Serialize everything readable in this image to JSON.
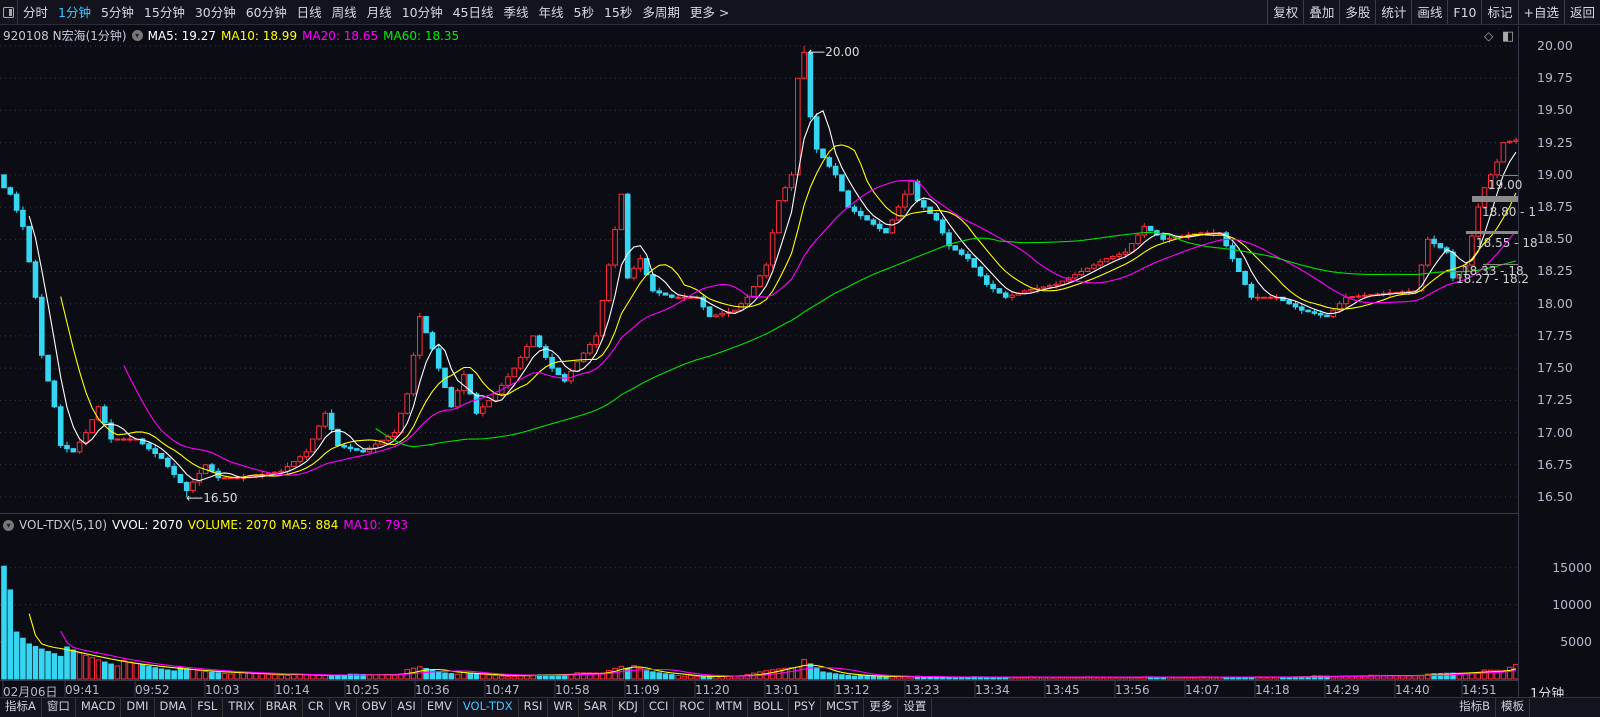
{
  "toolbar": {
    "periods": [
      "分时",
      "1分钟",
      "5分钟",
      "15分钟",
      "30分钟",
      "60分钟",
      "日线",
      "周线",
      "月线",
      "10分钟",
      "45日线",
      "季线",
      "年线",
      "5秒",
      "15秒",
      "多周期",
      "更多 >"
    ],
    "active_period": "1分钟",
    "right_buttons": [
      "复权",
      "叠加",
      "多股",
      "统计",
      "画线",
      "F10",
      "标记",
      "+自选",
      "返回"
    ]
  },
  "main_info": {
    "title": "920108 N宏海(1分钟)",
    "ma5": "MA5: 19.27",
    "ma10": "MA10: 18.99",
    "ma20": "MA20: 18.65",
    "ma60": "MA60: 18.35"
  },
  "vol_info": {
    "title": "VOL-TDX(5,10)",
    "vvol": "VVOL: 2070",
    "volume": "VOLUME: 2070",
    "ma5": "MA5: 884",
    "ma10": "MA10: 793"
  },
  "price_axis": [
    "20.00",
    "19.75",
    "19.50",
    "19.25",
    "19.00",
    "18.75",
    "18.50",
    "18.25",
    "18.00",
    "17.75",
    "17.50",
    "17.25",
    "17.00",
    "16.75",
    "16.50"
  ],
  "volume_axis": [
    "15000",
    "10000",
    "5000"
  ],
  "time_axis": [
    "02月06日",
    "09:41",
    "09:52",
    "10:03",
    "10:14",
    "10:25",
    "10:36",
    "10:47",
    "10:58",
    "11:09",
    "11:20",
    "13:01",
    "13:12",
    "13:23",
    "13:34",
    "13:45",
    "13:56",
    "14:07",
    "14:18",
    "14:29",
    "14:40",
    "14:51"
  ],
  "period_label": "1分钟",
  "annotations": {
    "high": "20.00",
    "low": "16.50"
  },
  "ranges": [
    "19.00",
    "18.80 - 1",
    "18.55 - 18",
    "18.33 - 18",
    "18.27 - 18.2"
  ],
  "bottom_tabs": [
    "指标A",
    "窗口",
    "MACD",
    "DMI",
    "DMA",
    "FSL",
    "TRIX",
    "BRAR",
    "CR",
    "VR",
    "OBV",
    "ASI",
    "EMV",
    "VOL-TDX",
    "RSI",
    "WR",
    "SAR",
    "KDJ",
    "CCI",
    "ROC",
    "MTM",
    "BOLL",
    "PSY",
    "MCST",
    "更多",
    "设置"
  ],
  "bottom_tabs_right": [
    "指标B",
    "模板"
  ],
  "active_tab": "VOL-TDX",
  "colors": {
    "up": "#ff2e3a",
    "down": "#36d6f2",
    "ma5": "#ffffff",
    "ma10": "#ffff00",
    "ma20": "#ff00ff",
    "ma60": "#00e000",
    "bg": "#0c0c14"
  },
  "chart_data": {
    "type": "candlestick",
    "minutes": 241,
    "ylim": [
      16.4,
      20.05
    ],
    "price_path": [
      [
        0,
        18.9
      ],
      [
        1,
        18.85
      ],
      [
        3,
        18.6
      ],
      [
        5,
        18.05
      ],
      [
        6,
        17.6
      ],
      [
        8,
        17.2
      ],
      [
        9,
        16.9
      ],
      [
        11,
        16.85
      ],
      [
        13,
        17.0
      ],
      [
        15,
        17.2
      ],
      [
        17,
        16.95
      ],
      [
        21,
        16.95
      ],
      [
        25,
        16.8
      ],
      [
        29,
        16.55
      ],
      [
        32,
        16.75
      ],
      [
        34,
        16.65
      ],
      [
        38,
        16.65
      ],
      [
        44,
        16.7
      ],
      [
        48,
        16.85
      ],
      [
        51,
        17.15
      ],
      [
        53,
        16.9
      ],
      [
        57,
        16.85
      ],
      [
        62,
        17.0
      ],
      [
        64,
        17.3
      ],
      [
        66,
        17.9
      ],
      [
        68,
        17.65
      ],
      [
        71,
        17.2
      ],
      [
        73,
        17.45
      ],
      [
        75,
        17.15
      ],
      [
        78,
        17.3
      ],
      [
        81,
        17.5
      ],
      [
        84,
        17.75
      ],
      [
        87,
        17.5
      ],
      [
        89,
        17.4
      ],
      [
        91,
        17.55
      ],
      [
        94,
        17.75
      ],
      [
        96,
        18.3
      ],
      [
        98,
        18.85
      ],
      [
        99,
        18.2
      ],
      [
        101,
        18.35
      ],
      [
        103,
        18.1
      ],
      [
        106,
        18.05
      ],
      [
        110,
        18.05
      ],
      [
        112,
        17.9
      ],
      [
        116,
        17.95
      ],
      [
        118,
        18.05
      ],
      [
        121,
        18.3
      ],
      [
        123,
        18.8
      ],
      [
        125,
        19.0
      ],
      [
        126,
        19.75
      ],
      [
        127,
        19.95
      ],
      [
        128,
        19.45
      ],
      [
        129,
        19.2
      ],
      [
        132,
        19.0
      ],
      [
        134,
        18.75
      ],
      [
        137,
        18.65
      ],
      [
        140,
        18.55
      ],
      [
        142,
        18.75
      ],
      [
        144,
        18.95
      ],
      [
        145,
        18.8
      ],
      [
        148,
        18.65
      ],
      [
        150,
        18.45
      ],
      [
        153,
        18.35
      ],
      [
        156,
        18.15
      ],
      [
        159,
        18.05
      ],
      [
        162,
        18.1
      ],
      [
        167,
        18.15
      ],
      [
        171,
        18.25
      ],
      [
        175,
        18.35
      ],
      [
        178,
        18.4
      ],
      [
        181,
        18.6
      ],
      [
        184,
        18.5
      ],
      [
        190,
        18.55
      ],
      [
        193,
        18.55
      ],
      [
        195,
        18.35
      ],
      [
        198,
        18.05
      ],
      [
        202,
        18.05
      ],
      [
        206,
        17.95
      ],
      [
        210,
        17.9
      ],
      [
        213,
        18.05
      ],
      [
        219,
        18.08
      ],
      [
        224,
        18.1
      ],
      [
        226,
        18.5
      ],
      [
        229,
        18.4
      ],
      [
        230,
        18.2
      ],
      [
        232,
        18.3
      ],
      [
        234,
        18.75
      ],
      [
        235,
        18.9
      ],
      [
        237,
        19.1
      ],
      [
        238,
        19.25
      ],
      [
        240,
        19.27
      ]
    ],
    "high": 20.0,
    "low": 16.5,
    "volume_path": [
      [
        0,
        19000
      ],
      [
        1,
        10000
      ],
      [
        2,
        5500
      ],
      [
        4,
        4500
      ],
      [
        8,
        4000
      ],
      [
        12,
        3200
      ],
      [
        18,
        2200
      ],
      [
        25,
        1500
      ],
      [
        32,
        1000
      ],
      [
        40,
        700
      ],
      [
        50,
        500
      ],
      [
        62,
        600
      ],
      [
        66,
        1500
      ],
      [
        70,
        900
      ],
      [
        80,
        400
      ],
      [
        95,
        800
      ],
      [
        98,
        2000
      ],
      [
        102,
        1000
      ],
      [
        110,
        300
      ],
      [
        118,
        500
      ],
      [
        125,
        1800
      ],
      [
        127,
        2200
      ],
      [
        130,
        900
      ],
      [
        136,
        400
      ],
      [
        150,
        250
      ],
      [
        200,
        250
      ],
      [
        225,
        500
      ],
      [
        232,
        900
      ],
      [
        238,
        1100
      ],
      [
        240,
        2070
      ]
    ],
    "volume_ylim": [
      0,
      19500
    ],
    "moving_averages": [
      5,
      10,
      20,
      60
    ]
  }
}
